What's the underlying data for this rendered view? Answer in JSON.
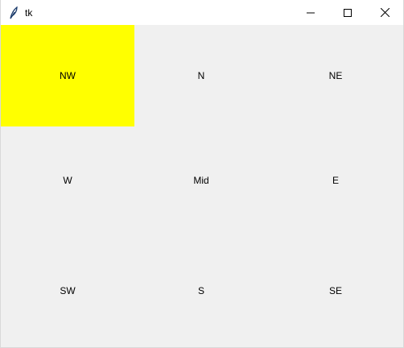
{
  "window": {
    "title": "tk",
    "controls": {
      "minimize": "minimize-icon",
      "maximize": "maximize-icon",
      "close": "close-icon"
    }
  },
  "grid": {
    "cells": [
      {
        "label": "NW",
        "bg": "#ffff00"
      },
      {
        "label": "N",
        "bg": "#f0f0f0"
      },
      {
        "label": "NE",
        "bg": "#f0f0f0"
      },
      {
        "label": "W",
        "bg": "#f0f0f0"
      },
      {
        "label": "Mid",
        "bg": "#f0f0f0"
      },
      {
        "label": "E",
        "bg": "#f0f0f0"
      },
      {
        "label": "SW",
        "bg": "#f0f0f0"
      },
      {
        "label": "S",
        "bg": "#f0f0f0"
      },
      {
        "label": "SE",
        "bg": "#f0f0f0"
      }
    ]
  },
  "colors": {
    "titlebar": "#ffffff",
    "window_bg": "#f0f0f0",
    "highlight": "#ffff00"
  }
}
